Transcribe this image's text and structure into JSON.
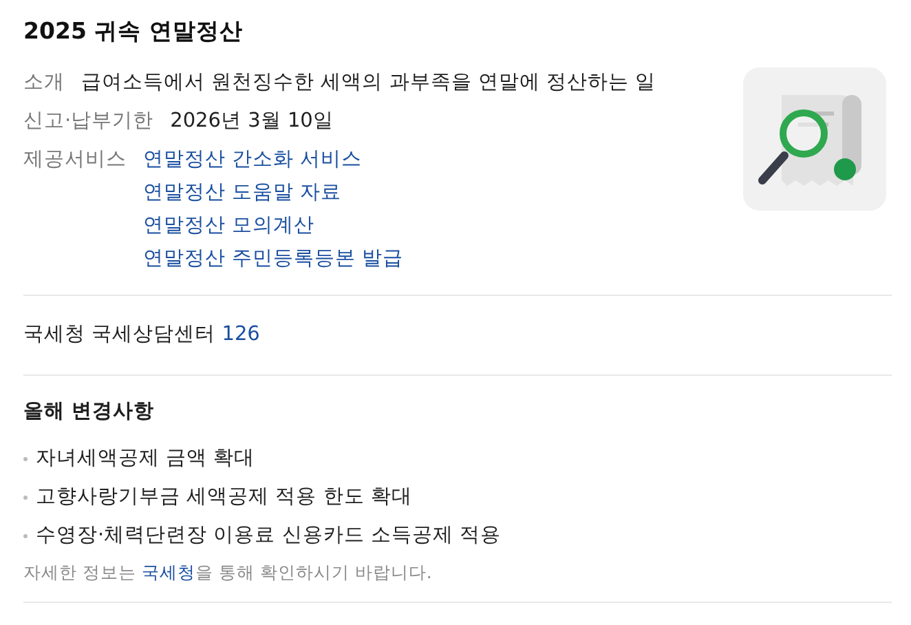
{
  "title": "2025 귀속 연말정산",
  "info": [
    {
      "label": "소개",
      "kind": "text",
      "value": "급여소득에서 원천징수한 세액의 과부족을 연말에 정산하는 일"
    },
    {
      "label": "신고·납부기한",
      "kind": "text",
      "value": "2026년 3월 10일"
    },
    {
      "label": "제공서비스",
      "kind": "links",
      "links": [
        "연말정산 간소화 서비스",
        "연말정산 도움말 자료",
        "연말정산 모의계산",
        "연말정산 주민등록등본 발급"
      ]
    }
  ],
  "contact": {
    "label": "국세청 국세상담센터",
    "number": "126"
  },
  "changes": {
    "title": "올해 변경사항",
    "items": [
      "자녀세액공제 금액 확대",
      "고향사랑기부금 세액공제 적용 한도 확대",
      "수영장·체력단련장 이용료 신용카드 소득공제 적용"
    ]
  },
  "note": {
    "before": "자세한 정보는 ",
    "link": "국세청",
    "after": "을 통해 확인하시기 바랍니다."
  }
}
